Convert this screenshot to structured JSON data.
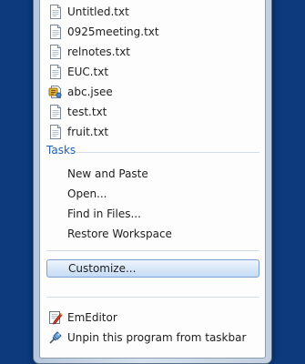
{
  "recent_files": [
    {
      "label": "Untitled.txt",
      "icon": "text-file-icon"
    },
    {
      "label": "0925meeting.txt",
      "icon": "text-file-icon"
    },
    {
      "label": "relnotes.txt",
      "icon": "text-file-icon"
    },
    {
      "label": "EUC.txt",
      "icon": "text-file-icon"
    },
    {
      "label": "abc.jsee",
      "icon": "script-file-icon"
    },
    {
      "label": "test.txt",
      "icon": "text-file-icon"
    },
    {
      "label": "fruit.txt",
      "icon": "text-file-icon"
    }
  ],
  "tasks": {
    "header": "Tasks",
    "items": [
      "New and Paste",
      "Open...",
      "Find in Files...",
      "Restore Workspace"
    ]
  },
  "customize_label": "Customize...",
  "bottom": {
    "app_label": "EmEditor",
    "unpin_label": "Unpin this program from taskbar"
  },
  "colors": {
    "desktop": "#0c3a7c",
    "category_text": "#1e5fb5",
    "highlight_border": "#7da2ce"
  }
}
